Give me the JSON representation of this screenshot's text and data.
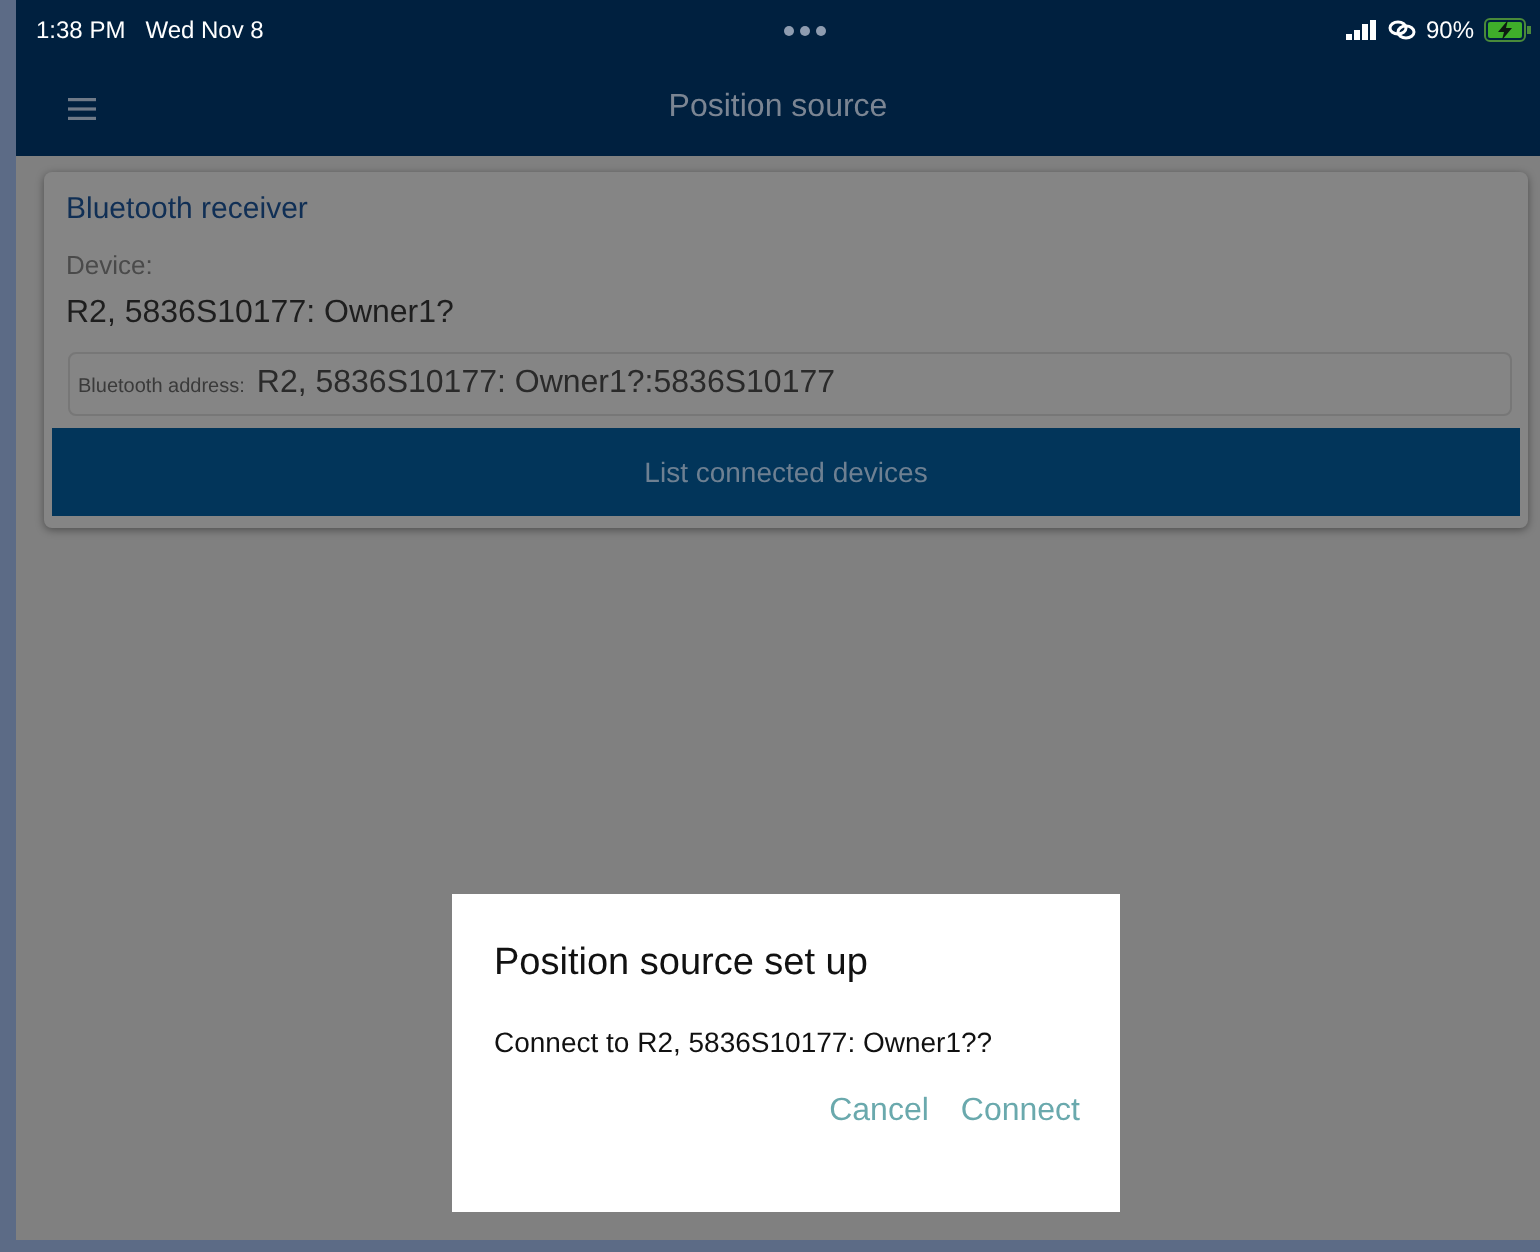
{
  "status_bar": {
    "time": "1:38 PM",
    "date": "Wed Nov 8",
    "battery": "90%"
  },
  "nav_bar": {
    "title": "Position source"
  },
  "card": {
    "title": "Bluetooth receiver",
    "device_label": "Device:",
    "device_value": "R2, 5836S10177: Owner1?",
    "address_label": "Bluetooth address:",
    "address_value": "R2, 5836S10177: Owner1?:5836S10177",
    "button": "List connected devices"
  },
  "dialog": {
    "title": "Position source set up",
    "message": "Connect to R2, 5836S10177: Owner1??",
    "buttons": [
      "Cancel",
      "Connect"
    ]
  }
}
